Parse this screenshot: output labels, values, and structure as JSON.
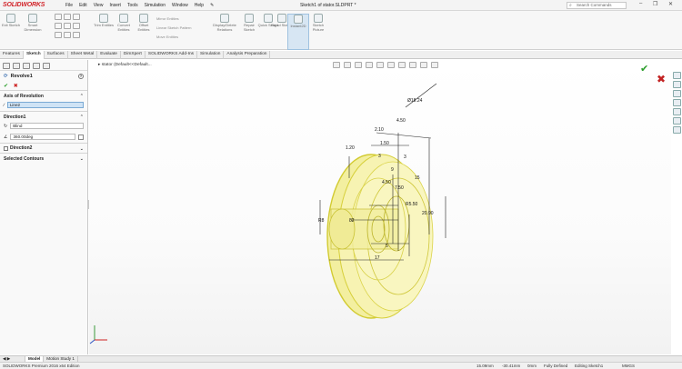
{
  "app": {
    "brand": "SOLIDWORKS",
    "document_title": "Sketch1 of stator.SLDPRT *"
  },
  "menu": [
    "File",
    "Edit",
    "View",
    "Insert",
    "Tools",
    "Simulation",
    "Window",
    "Help"
  ],
  "search": {
    "placeholder": "Search Commands"
  },
  "commands": {
    "exit_sketch": "Exit Sketch",
    "smart_dimension": "Smart Dimension",
    "trim_entities": "Trim Entities",
    "convert_entities": "Convert Entities",
    "offset_entities": "Offset Entities",
    "mirror_entities": "Mirror Entities",
    "linear_sketch_pattern": "Linear Sketch Pattern",
    "move_entities": "Move Entities",
    "display_delete_relations": "Display/Delete Relations",
    "repair_sketch": "Repair Sketch",
    "quick_snaps": "Quick Snaps",
    "rapid_sketch": "Rapid Sketch",
    "instant2d": "Instant2D",
    "sketch_picture": "Sketch Picture"
  },
  "tabs": [
    "Features",
    "Sketch",
    "Surfaces",
    "Sheet Metal",
    "Evaluate",
    "DimXpert",
    "SOLIDWORKS Add-Ins",
    "Simulation",
    "Analysis Preparation"
  ],
  "active_tab": "Sketch",
  "feature": {
    "name": "Revolve1",
    "axis_section": "Axis of Revolution",
    "axis_value": "Line2",
    "direction1_section": "Direction1",
    "end_condition": "Blind",
    "angle": "360.00deg",
    "direction2_label": "Direction2",
    "contours_section": "Selected Contours"
  },
  "breadcrumb": "stator (Default<<Default...",
  "dimensions": [
    "Ø18.24",
    "4.50",
    "2.10",
    "1.50",
    "1.20",
    "3",
    "9",
    "3",
    "4.50",
    "7.50",
    "R5.50",
    "15",
    "20.90",
    "R8",
    "82",
    "5",
    "17"
  ],
  "bottom_tabs": [
    "Model",
    "Motion Study 1"
  ],
  "status": {
    "edition": "SOLIDWORKS Premium 2016 x64 Edition",
    "x": "15.09mm",
    "y": "-30.41mm",
    "z": "0mm",
    "state": "Fully Defined",
    "editing": "Editing Sketch1",
    "units": "MMGS"
  },
  "colors": {
    "accent": "#d2242a",
    "model_fill": "#f6f2a0",
    "model_edge": "#d6cf3a",
    "ok": "#2a9d2a",
    "cancel": "#c22222"
  }
}
